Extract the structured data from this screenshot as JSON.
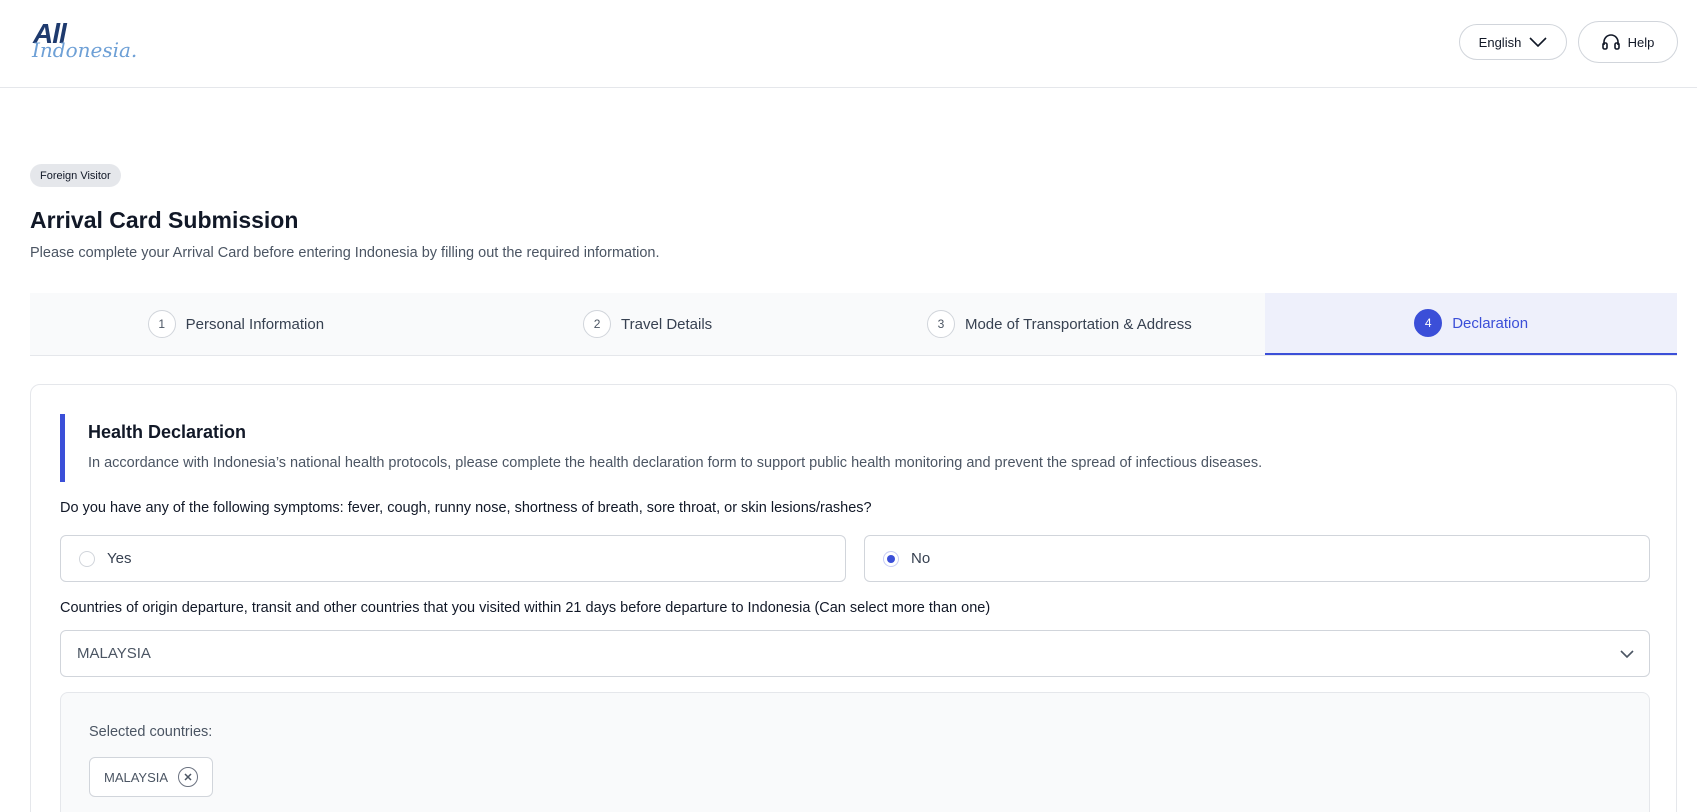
{
  "header": {
    "logo_line1": "All",
    "logo_line2": "Indonesia.",
    "language_label": "English",
    "help_label": "Help"
  },
  "page": {
    "badge": "Foreign Visitor",
    "title": "Arrival Card Submission",
    "subtitle": "Please complete your Arrival Card before entering Indonesia by filling out the required information."
  },
  "stepper": {
    "steps": [
      {
        "num": "1",
        "label": "Personal Information"
      },
      {
        "num": "2",
        "label": "Travel Details"
      },
      {
        "num": "3",
        "label": "Mode of Transportation & Address"
      },
      {
        "num": "4",
        "label": "Declaration"
      }
    ],
    "active_index": 3
  },
  "health": {
    "title": "Health Declaration",
    "description": "In accordance with Indonesia’s national health protocols, please complete the health declaration form to support public health monitoring and prevent the spread of infectious diseases.",
    "symptoms_question": "Do you have any of the following symptoms: fever, cough, runny nose, shortness of breath, sore throat, or skin lesions/rashes?",
    "option_yes": "Yes",
    "option_no": "No",
    "selected_option": "No",
    "countries_question": "Countries of origin departure, transit and other countries that you visited within 21 days before departure to Indonesia (Can select more than one)",
    "countries_select_value": "MALAYSIA",
    "selected_countries_label": "Selected countries:",
    "selected_countries": [
      "MALAYSIA"
    ]
  },
  "colors": {
    "accent": "#3b4fd8",
    "active_step_bg": "#eef0fb"
  }
}
